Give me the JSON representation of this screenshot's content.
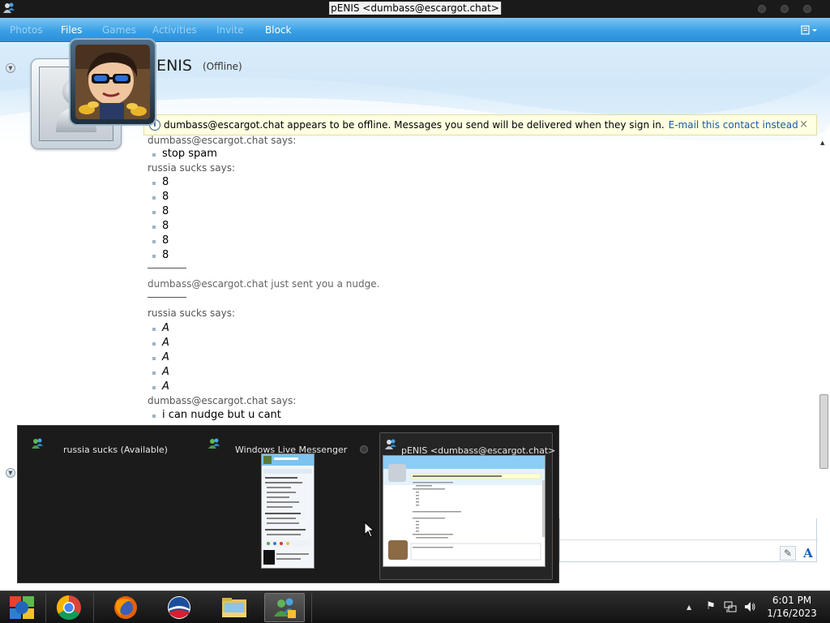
{
  "window": {
    "title": "pENIS <dumbass@escargot.chat>"
  },
  "menu": {
    "items": [
      {
        "label": "Photos",
        "active": false
      },
      {
        "label": "Files",
        "active": true
      },
      {
        "label": "Games",
        "active": false
      },
      {
        "label": "Activities",
        "active": false
      },
      {
        "label": "Invite",
        "active": false
      },
      {
        "label": "Block",
        "active": true
      }
    ],
    "options_icon": "menu-options-icon"
  },
  "contact": {
    "name": "pENIS",
    "status": "(Offline)"
  },
  "infobar": {
    "message": "dumbass@escargot.chat appears to be offline. Messages you send will be delivered when they sign in.",
    "link": "E-mail this contact instead",
    "close": "×"
  },
  "conversation": [
    {
      "type": "sender",
      "text": "dumbass@escargot.chat says:"
    },
    {
      "type": "msg",
      "text": "stop spam"
    },
    {
      "type": "sender",
      "text": "russia sucks says:"
    },
    {
      "type": "msg",
      "text": "8"
    },
    {
      "type": "msg",
      "text": "8"
    },
    {
      "type": "msg",
      "text": "8"
    },
    {
      "type": "msg",
      "text": "8"
    },
    {
      "type": "msg",
      "text": "8"
    },
    {
      "type": "msg",
      "text": "8"
    },
    {
      "type": "sep"
    },
    {
      "type": "nudge",
      "text": "dumbass@escargot.chat just sent you a nudge."
    },
    {
      "type": "sep"
    },
    {
      "type": "sender",
      "text": "russia sucks says:"
    },
    {
      "type": "msg_italic",
      "text": "A"
    },
    {
      "type": "msg_italic",
      "text": "A"
    },
    {
      "type": "msg_italic",
      "text": "A"
    },
    {
      "type": "msg_italic",
      "text": "A"
    },
    {
      "type": "msg_italic",
      "text": "A"
    },
    {
      "type": "sender",
      "text": "dumbass@escargot.chat says:"
    },
    {
      "type": "msg",
      "text": "i can nudge but u cant"
    }
  ],
  "thumbnails": [
    {
      "label": "russia sucks (Available)"
    },
    {
      "label": "Windows Live Messenger"
    },
    {
      "label": "pENIS <dumbass@escargot.chat>"
    }
  ],
  "taskbar": {
    "apps": [
      "start-orb-icon",
      "chrome-icon",
      "firefox-icon",
      "obama-campaign-icon",
      "file-explorer-icon",
      "messenger-icon"
    ],
    "time": "6:01 PM",
    "date": "1/16/2023"
  }
}
